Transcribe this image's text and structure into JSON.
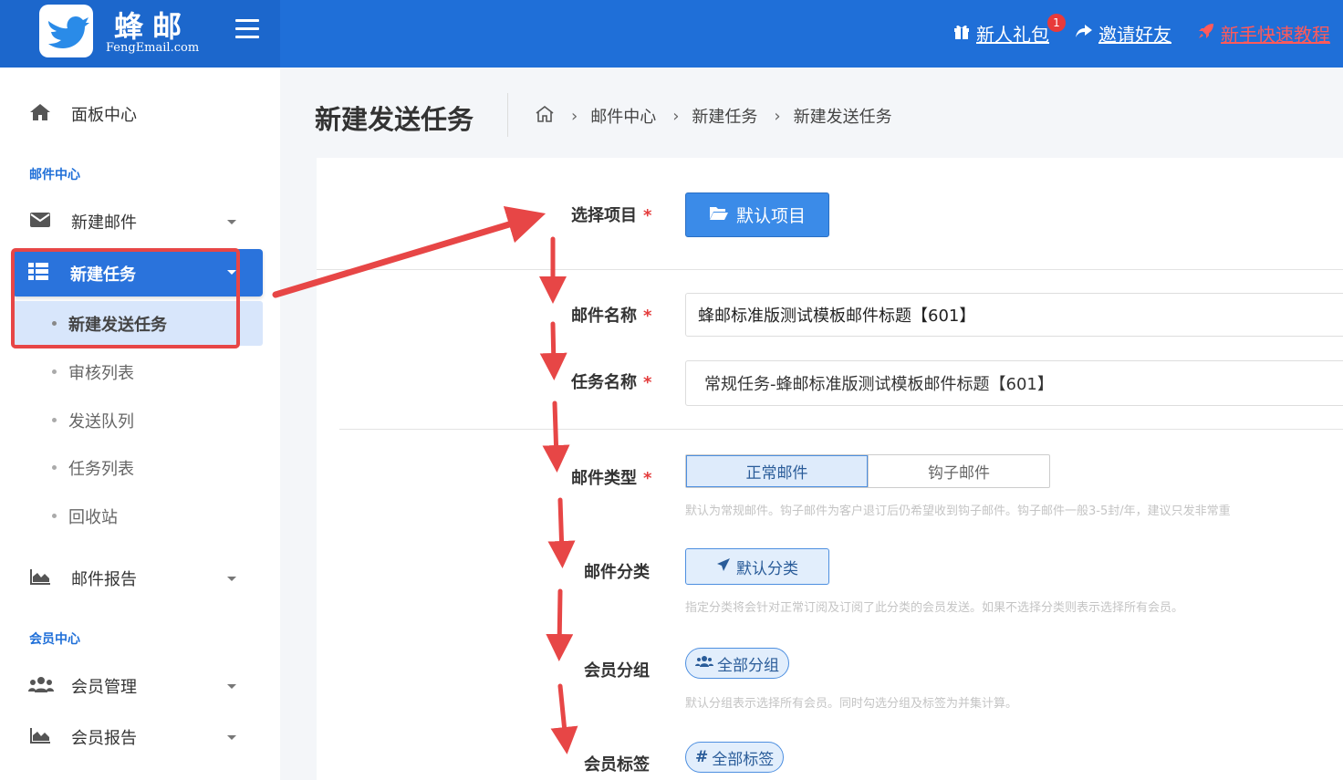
{
  "header": {
    "brand_name": "蜂邮",
    "brand_domain": "FengEmail.com",
    "links": [
      {
        "label": "新人礼包",
        "icon": "gift-icon",
        "badge": "1"
      },
      {
        "label": "邀请好友",
        "icon": "share-icon"
      },
      {
        "label": "新手快速教程",
        "icon": "rocket-icon"
      }
    ]
  },
  "sidebar": {
    "dashboard": "面板中心",
    "section_mail": "邮件中心",
    "new_mail": "新建邮件",
    "new_task": "新建任务",
    "sub_items": [
      "新建发送任务",
      "审核列表",
      "发送队列",
      "任务列表",
      "回收站"
    ],
    "mail_report": "邮件报告",
    "section_member": "会员中心",
    "member_manage": "会员管理",
    "member_report": "会员报告"
  },
  "page": {
    "title": "新建发送任务",
    "breadcrumb": [
      "邮件中心",
      "新建任务",
      "新建发送任务"
    ]
  },
  "form": {
    "project_label": "选择项目",
    "project_button": "默认项目",
    "mail_name_label": "邮件名称",
    "mail_name_value": "蜂邮标准版测试模板邮件标题【601】",
    "task_name_label": "任务名称",
    "task_name_value": "常规任务-蜂邮标准版测试模板邮件标题【601】",
    "mail_type_label": "邮件类型",
    "mail_type_options": [
      "正常邮件",
      "钩子邮件"
    ],
    "mail_type_selected": "正常邮件",
    "mail_type_help": "默认为常规邮件。钩子邮件为客户退订后仍希望收到钩子邮件。钩子邮件一般3-5封/年，建议只发非常重",
    "category_label": "邮件分类",
    "category_button": "默认分类",
    "category_help": "指定分类将会针对正常订阅及订阅了此分类的会员发送。如果不选择分类则表示选择所有会员。",
    "group_label": "会员分组",
    "group_button": "全部分组",
    "group_help": "默认分组表示选择所有会员。同时勾选分组及标签为并集计算。",
    "tag_label": "会员标签",
    "tag_button": "全部标签"
  },
  "colors": {
    "header_bg": "#1f6fd8",
    "accent": "#3b8be8",
    "annotation": "#e74646"
  }
}
